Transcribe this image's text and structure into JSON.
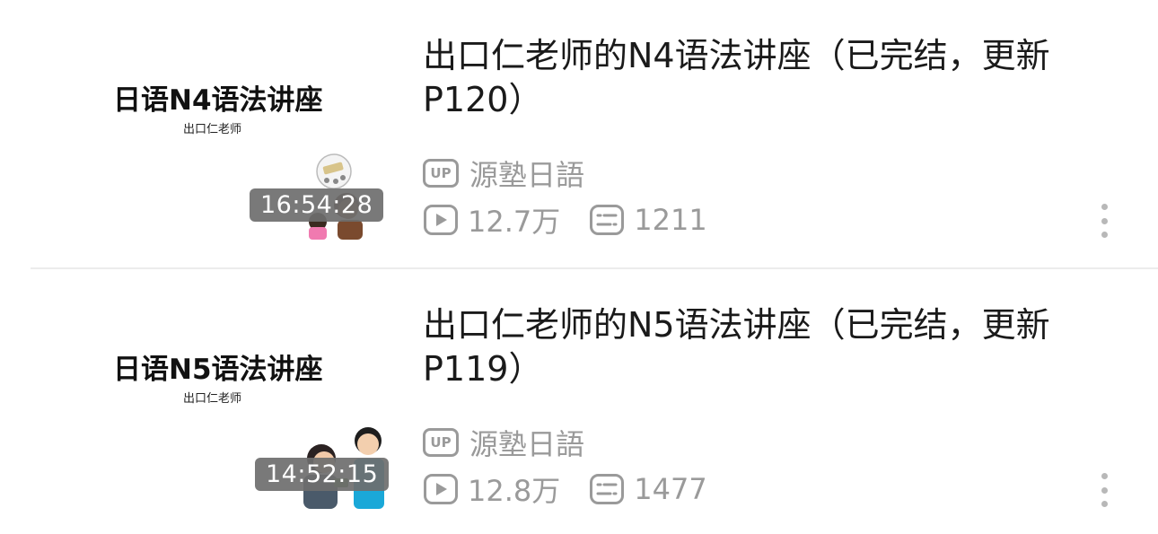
{
  "videos": [
    {
      "thumb_title": "日语N4语法讲座",
      "thumb_subtitle": "出口仁老师",
      "duration": "16:54:28",
      "title": "出口仁老师的N4语法讲座（已完结，更新P120）",
      "up_badge": "UP",
      "uploader": "源塾日語",
      "views": "12.7万",
      "danmaku": "1211"
    },
    {
      "thumb_title": "日语N5语法讲座",
      "thumb_subtitle": "出口仁老师",
      "duration": "14:52:15",
      "title": "出口仁老师的N5语法讲座（已完结，更新P119）",
      "up_badge": "UP",
      "uploader": "源塾日語",
      "views": "12.8万",
      "danmaku": "1477"
    }
  ],
  "icons": {
    "up": "up-badge-icon",
    "views": "play-icon",
    "danmaku": "danmaku-icon",
    "more": "more-vertical-icon"
  },
  "colors": {
    "meta_gray": "#9a9a9a",
    "title_text": "#1a1a1a",
    "duration_bg": "#6e6e6e"
  }
}
